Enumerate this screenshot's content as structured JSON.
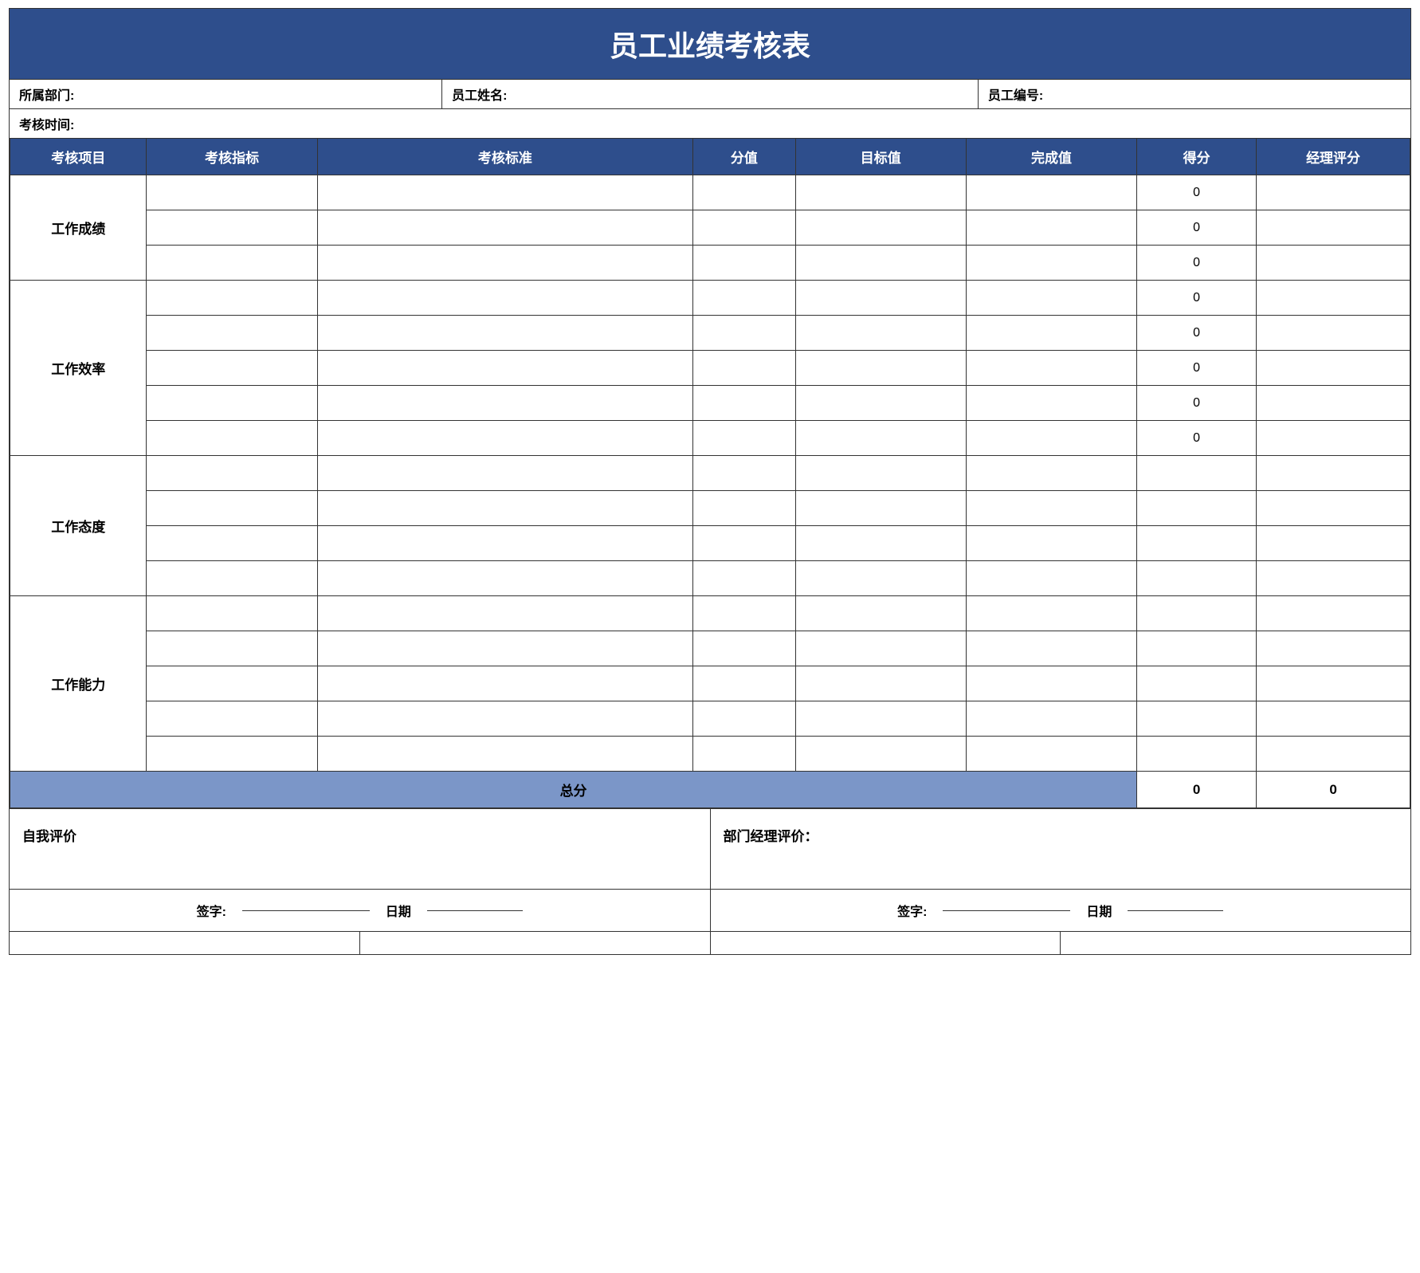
{
  "title": "员工业绩考核表",
  "info": {
    "dept_label": "所属部门:",
    "dept_value": "",
    "name_label": "员工姓名:",
    "name_value": "",
    "id_label": "员工编号:",
    "id_value": "",
    "time_label": "考核时间:",
    "time_value": ""
  },
  "headers": {
    "col1": "考核项目",
    "col2": "考核指标",
    "col3": "考核标准",
    "col4": "分值",
    "col5": "目标值",
    "col6": "完成值",
    "col7": "得分",
    "col8": "经理评分"
  },
  "categories": {
    "gongzuo_chengjii": "工作成绩",
    "gongzuo_xiaolv": "工作效率",
    "gongzuo_taidu": "工作态度",
    "gongzuo_nengli": "工作能力"
  },
  "rows": {
    "chengjii_scores": [
      "0",
      "0",
      "0"
    ],
    "xiaolv_scores": [
      "0",
      "0",
      "0",
      "0",
      "0"
    ],
    "taidu_scores": [
      "",
      "",
      "",
      ""
    ],
    "nengli_scores": [
      "",
      "",
      "",
      "",
      ""
    ]
  },
  "total": {
    "label": "总分",
    "score": "0",
    "manager_score": "0"
  },
  "bottom": {
    "self_eval_label": "自我评价",
    "dept_eval_label": "部门经理评价："
  },
  "sign": {
    "sign_label": "签字:",
    "date_label": "日期",
    "sign_label2": "签字:",
    "date_label2": "日期"
  }
}
